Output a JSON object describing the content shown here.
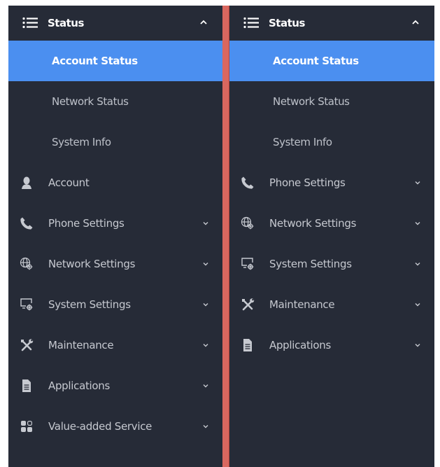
{
  "colors": {
    "panel_bg": "#262b37",
    "active_bg": "#4b8ff0",
    "divider": "#d9675f",
    "text": "#c6c9d0",
    "text_active": "#ffffff"
  },
  "left": {
    "header": {
      "title": "Status",
      "icon": "hamburger-icon",
      "toggle_icon": "chevron-up-icon"
    },
    "sub_items": [
      {
        "label": "Account Status",
        "active": true
      },
      {
        "label": "Network Status",
        "active": false
      },
      {
        "label": "System Info",
        "active": false
      }
    ],
    "items": [
      {
        "label": "Account",
        "icon": "user-icon",
        "expandable": false
      },
      {
        "label": "Phone Settings",
        "icon": "phone-icon",
        "expandable": true
      },
      {
        "label": "Network Settings",
        "icon": "network-gear-icon",
        "expandable": true
      },
      {
        "label": "System Settings",
        "icon": "monitor-gear-icon",
        "expandable": true
      },
      {
        "label": "Maintenance",
        "icon": "tools-icon",
        "expandable": true
      },
      {
        "label": "Applications",
        "icon": "document-icon",
        "expandable": true
      },
      {
        "label": "Value-added Service",
        "icon": "grid-icon",
        "expandable": true
      }
    ]
  },
  "right": {
    "header": {
      "title": "Status",
      "icon": "hamburger-icon",
      "toggle_icon": "chevron-up-icon"
    },
    "sub_items": [
      {
        "label": "Account Status",
        "active": true
      },
      {
        "label": "Network Status",
        "active": false
      },
      {
        "label": "System Info",
        "active": false
      }
    ],
    "items": [
      {
        "label": "Phone Settings",
        "icon": "phone-icon",
        "expandable": true
      },
      {
        "label": "Network Settings",
        "icon": "network-gear-icon",
        "expandable": true
      },
      {
        "label": "System Settings",
        "icon": "monitor-gear-icon",
        "expandable": true
      },
      {
        "label": "Maintenance",
        "icon": "tools-icon",
        "expandable": true
      },
      {
        "label": "Applications",
        "icon": "document-icon",
        "expandable": true
      }
    ]
  }
}
